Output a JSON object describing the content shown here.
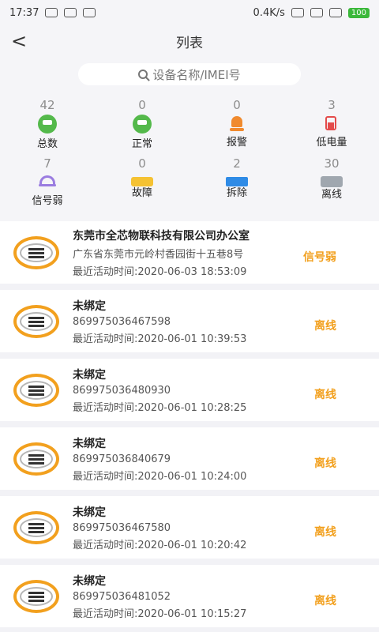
{
  "status_bar": {
    "time": "17:37",
    "network_speed": "0.4K/s",
    "battery_level": "100"
  },
  "header": {
    "title": "列表"
  },
  "search": {
    "placeholder": "设备名称/IMEI号"
  },
  "stats": {
    "row1": [
      {
        "label": "总数",
        "count": "42",
        "icon": "device-icon"
      },
      {
        "label": "正常",
        "count": "0",
        "icon": "device-icon"
      },
      {
        "label": "报警",
        "count": "0",
        "icon": "alarm-icon"
      },
      {
        "label": "低电量",
        "count": "3",
        "icon": "battery-low-icon"
      }
    ],
    "row2": [
      {
        "label": "信号弱",
        "count": "7",
        "icon": "signal-weak-icon"
      },
      {
        "label": "故障",
        "count": "0",
        "icon": "fault-icon"
      },
      {
        "label": "拆除",
        "count": "2",
        "icon": "remove-icon"
      },
      {
        "label": "离线",
        "count": "30",
        "icon": "offline-icon"
      }
    ]
  },
  "devices": [
    {
      "title": "东莞市全芯物联科技有限公司办公室",
      "subtitle": "广东省东莞市元岭村香园街十五巷8号",
      "time": "最近活动时间:2020-06-03 18:53:09",
      "status": "信号弱"
    },
    {
      "title": "未绑定",
      "subtitle": "869975036467598",
      "time": "最近活动时间:2020-06-01 10:39:53",
      "status": "离线"
    },
    {
      "title": "未绑定",
      "subtitle": "869975036480930",
      "time": "最近活动时间:2020-06-01 10:28:25",
      "status": "离线"
    },
    {
      "title": "未绑定",
      "subtitle": "869975036840679",
      "time": "最近活动时间:2020-06-01 10:24:00",
      "status": "离线"
    },
    {
      "title": "未绑定",
      "subtitle": "869975036467580",
      "time": "最近活动时间:2020-06-01 10:20:42",
      "status": "离线"
    },
    {
      "title": "未绑定",
      "subtitle": "869975036481052",
      "time": "最近活动时间:2020-06-01 10:15:27",
      "status": "离线"
    }
  ],
  "colors": {
    "accent": "#f2a01e",
    "normal": "#54b94b"
  }
}
